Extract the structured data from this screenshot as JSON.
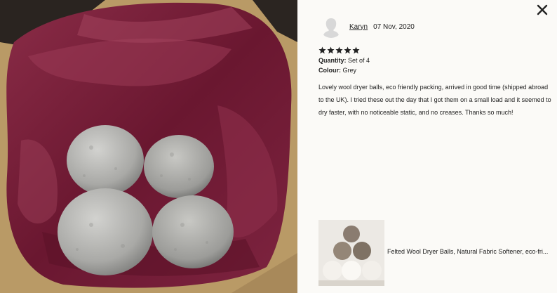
{
  "review": {
    "reviewer_name": "Karyn",
    "date": "07 Nov, 2020",
    "rating": 5,
    "quantity_label": "Quantity:",
    "quantity_value": "Set of 4",
    "colour_label": "Colour:",
    "colour_value": "Grey",
    "text": "Lovely wool dryer balls, eco friendly packing, arrived in good time (shipped abroad to the UK). I tried these out the day that I got them on a small load and it seemed to dry faster, with no noticeable static, and no creases. Thanks so much!"
  },
  "product": {
    "title": "Felted Wool Dryer Balls, Natural Fabric Softener, eco-fri..."
  },
  "icons": {
    "close": "close-icon",
    "avatar": "user-silhouette-icon",
    "star": "star-icon"
  },
  "colors": {
    "panel_bg": "#fbfaf7",
    "tissue": "#7a1f38",
    "star": "#222222"
  }
}
